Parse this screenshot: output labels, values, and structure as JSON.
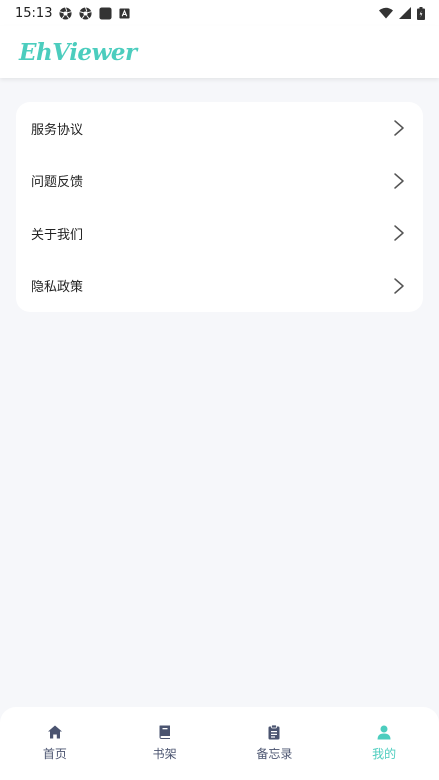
{
  "status_bar": {
    "time": "15:13",
    "left_icons": [
      "aperture-icon",
      "aperture-icon",
      "square-app-icon",
      "font-a-icon"
    ],
    "right_icons": [
      "wifi-icon",
      "signal-icon",
      "battery-icon"
    ]
  },
  "app_bar": {
    "logo_text": "EhViewer"
  },
  "menu": {
    "items": [
      {
        "label": "服务协议",
        "icon": "chevron-right-icon"
      },
      {
        "label": "问题反馈",
        "icon": "chevron-right-icon"
      },
      {
        "label": "关于我们",
        "icon": "chevron-right-icon"
      },
      {
        "label": "隐私政策",
        "icon": "chevron-right-icon"
      }
    ]
  },
  "bottom_nav": {
    "items": [
      {
        "label": "首页",
        "icon": "home-icon",
        "active": false
      },
      {
        "label": "书架",
        "icon": "book-icon",
        "active": false
      },
      {
        "label": "备忘录",
        "icon": "clipboard-icon",
        "active": false
      },
      {
        "label": "我的",
        "icon": "person-icon",
        "active": true
      }
    ]
  },
  "colors": {
    "accent": "#4ccdbe",
    "background": "#f6f7fa",
    "card": "#ffffff",
    "nav_inactive": "#4b5470",
    "text": "#222222"
  }
}
